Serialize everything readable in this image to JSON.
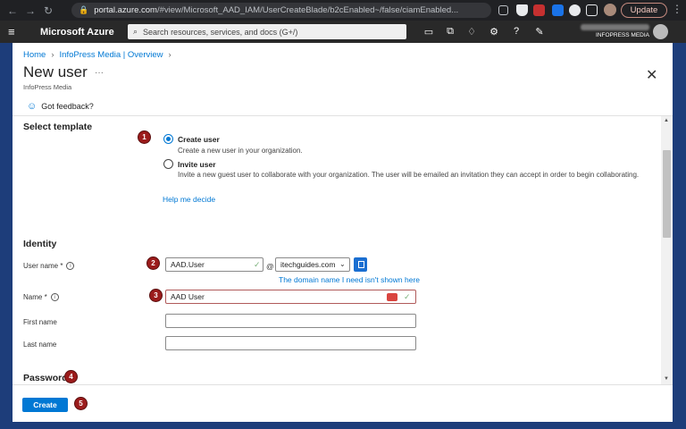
{
  "browser": {
    "url_domain": "portal.azure.com",
    "url_rest": "/#view/Microsoft_AAD_IAM/UserCreateBlade/b2cEnabled~/false/ciamEnabled...",
    "update_label": "Update"
  },
  "azure": {
    "brand": "Microsoft Azure",
    "search_placeholder": "Search resources, services, and docs (G+/)",
    "tenant": "INFOPRESS MEDIA"
  },
  "breadcrumb": [
    "Home",
    "InfoPress Media | Overview"
  ],
  "blade": {
    "title": "New user",
    "more": "···",
    "subtitle": "InfoPress Media",
    "feedback": "Got feedback?"
  },
  "template": {
    "section_title": "Select template",
    "options": [
      {
        "label": "Create user",
        "desc": "Create a new user in your organization.",
        "selected": true
      },
      {
        "label": "Invite user",
        "desc": "Invite a new guest user to collaborate with your organization. The user will be emailed an invitation they can accept in order to begin collaborating.",
        "selected": false
      }
    ],
    "help_link": "Help me decide"
  },
  "identity": {
    "section_title": "Identity",
    "user_name_label": "User name *",
    "user_name_value": "AAD.User",
    "at": "@",
    "domain_value": "itechguides.com",
    "domain_link": "The domain name I need isn't shown here",
    "name_label": "Name *",
    "name_value": "AAD User",
    "first_name_label": "First name",
    "first_name_value": "",
    "last_name_label": "Last name",
    "last_name_value": ""
  },
  "password": {
    "section_title": "Password"
  },
  "actions": {
    "create_label": "Create"
  },
  "badges": [
    "1",
    "2",
    "3",
    "4",
    "5"
  ],
  "colors": {
    "accent": "#0078d4",
    "badge": "#9b1c1c",
    "azure_bar": "#292929"
  }
}
